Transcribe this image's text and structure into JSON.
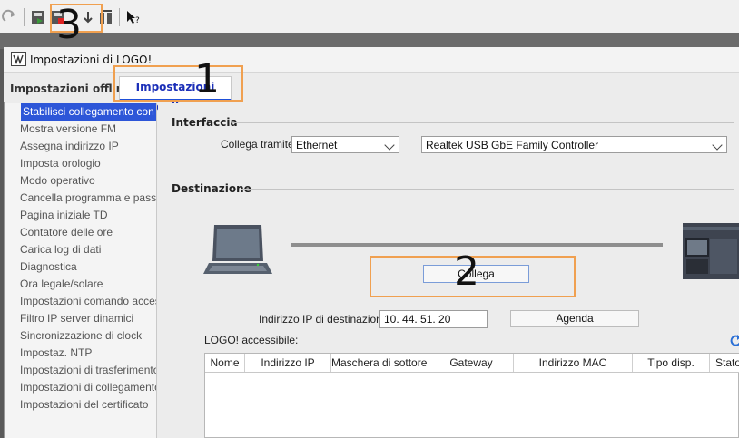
{
  "window": {
    "title": "Impostazioni di LOGO!"
  },
  "tabs": [
    {
      "label": "Impostazioni offline",
      "active": false
    },
    {
      "label": "Impostazioni online",
      "active": true
    }
  ],
  "sidebar": {
    "items": [
      {
        "label": "Stabilisci collegamento con LOGO!",
        "selected": true
      },
      {
        "label": "Mostra versione FM"
      },
      {
        "label": "Assegna indirizzo IP"
      },
      {
        "label": "Imposta orologio"
      },
      {
        "label": "Modo operativo"
      },
      {
        "label": "Cancella programma e password"
      },
      {
        "label": "Pagina iniziale TD"
      },
      {
        "label": "Contatore delle ore"
      },
      {
        "label": "Carica log di dati"
      },
      {
        "label": "Diagnostica"
      },
      {
        "label": "Ora legale/solare"
      },
      {
        "label": "Impostazioni comando accesso"
      },
      {
        "label": "Filtro IP server dinamici"
      },
      {
        "label": "Sincronizzazione di clock"
      },
      {
        "label": "Impostaz. NTP"
      },
      {
        "label": "Impostazioni di trasferimento d"
      },
      {
        "label": "Impostazioni di collegamento a"
      },
      {
        "label": "Impostazioni del certificato"
      }
    ]
  },
  "interface": {
    "section_title": "Interfaccia",
    "connect_label": "Collega tramite:",
    "connection_type": "Ethernet",
    "adapter": "Realtek USB GbE Family Controller"
  },
  "destination": {
    "section_title": "Destinazione",
    "connect_button": "Collega",
    "ip_label": "Indirizzo IP di destinazione:",
    "ip_value": "10. 44. 51. 20",
    "agenda_button": "Agenda",
    "accessible_label": "LOGO! accessibile:"
  },
  "table": {
    "columns": [
      "Nome",
      "Indirizzo IP",
      "Maschera di sottore…",
      "Gateway",
      "Indirizzo MAC",
      "Tipo disp.",
      "Stato"
    ]
  },
  "annotations": {
    "n1": "1",
    "n2": "2",
    "n3": "3"
  },
  "colors": {
    "accent": "#2d56d8",
    "annotation": "#f0a050",
    "tab_text": "#1b2fb8"
  }
}
